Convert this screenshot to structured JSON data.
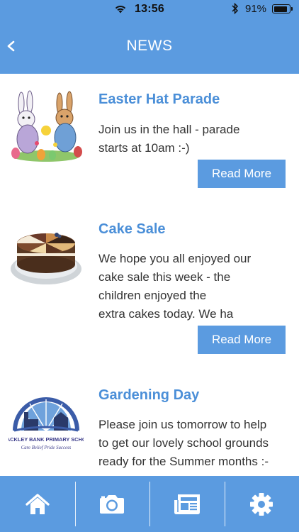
{
  "status_bar": {
    "time": "13:56",
    "battery_percent": "91%",
    "battery_level": 0.91
  },
  "header": {
    "title": "NEWS",
    "back_icon": "chevron-left-icon"
  },
  "news": [
    {
      "title": "Easter Hat Parade",
      "lines": [
        "Join us in the hall - parade",
        "starts at 10am :-)"
      ],
      "button_label": "Read More",
      "image": "easter-bunnies-image"
    },
    {
      "title": "Cake Sale",
      "lines": [
        "We hope you all enjoyed our",
        "cake sale this week - the",
        "children enjoyed the",
        "extra cakes today.  We ha"
      ],
      "button_label": "Read More",
      "image": "cake-image"
    },
    {
      "title": "Gardening Day",
      "lines": [
        "Please join us tomorrow to help",
        "to get our lovely school grounds",
        "ready for the Summer months :-"
      ],
      "image": "school-logo-image",
      "logo_text": [
        "CRACKLEY BANK PRIMARY SCHOOL",
        "Care Belief Pride Success"
      ]
    }
  ],
  "tab_bar": {
    "tabs": [
      {
        "icon": "home-icon"
      },
      {
        "icon": "camera-icon"
      },
      {
        "icon": "newspaper-icon"
      },
      {
        "icon": "gear-icon"
      }
    ]
  },
  "colors": {
    "brand_blue": "#5b9be0",
    "title_blue": "#4b8fd8",
    "body_text": "#333333",
    "white": "#ffffff"
  }
}
